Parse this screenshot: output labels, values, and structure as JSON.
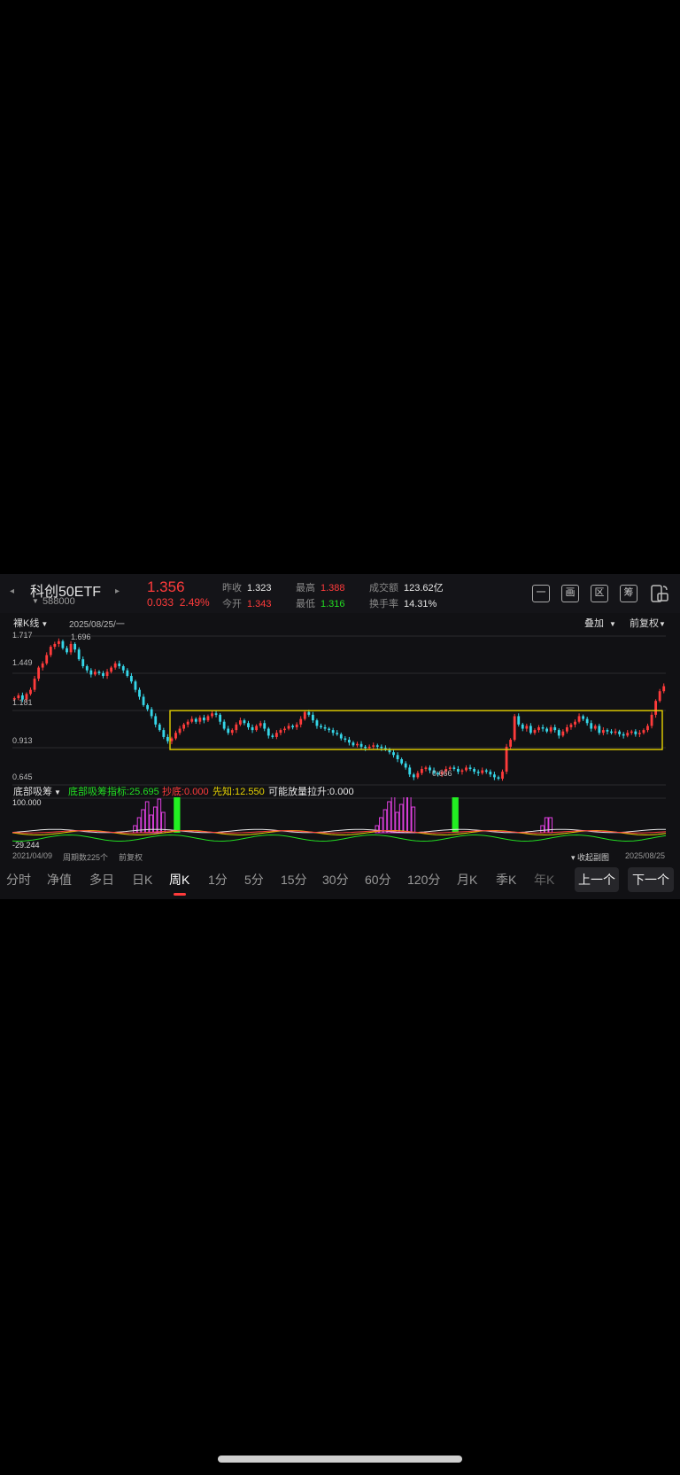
{
  "header": {
    "name": "科创50ETF",
    "code": "588000",
    "price": "1.356",
    "change": "0.033",
    "change_pct": "2.49%",
    "quotes": [
      {
        "key": "昨收",
        "value": "1.323",
        "tone": "white"
      },
      {
        "key": "今开",
        "value": "1.343",
        "tone": "red"
      },
      {
        "key": "最高",
        "value": "1.388",
        "tone": "red"
      },
      {
        "key": "最低",
        "value": "1.316",
        "tone": "green"
      },
      {
        "key": "成交额",
        "value": "123.62亿",
        "tone": "white"
      },
      {
        "key": "换手率",
        "value": "14.31%",
        "tone": "white"
      }
    ],
    "tools": [
      "一",
      "画",
      "区",
      "筹"
    ]
  },
  "chart": {
    "mode_label": "裸K线",
    "date_label": "2025/08/25/一",
    "overlay_label": "叠加",
    "adjust_label": "前复权",
    "y_labels": [
      "1.717",
      "1.449",
      "1.181",
      "0.913",
      "0.645"
    ],
    "high_note": "1.696",
    "low_note": "0.666",
    "up_color": "#ff3b3b",
    "down_color": "#35d6e8",
    "box_color": "#e6d200"
  },
  "indicator": {
    "name": "底部吸筹",
    "main": "底部吸筹指标:25.695",
    "chaodi": "抄底:0.000",
    "xianzhi": "先知:12.550",
    "lashen": "可能放量拉升:0.000",
    "top": "100.000",
    "bottom": "-29.244"
  },
  "footer": {
    "start_date": "2021/04/09",
    "period_count": "周期数225个",
    "adjust": "前复权",
    "collapse": "收起副图",
    "end_date": "2025/08/25"
  },
  "tabs": [
    "分时",
    "净值",
    "多日",
    "日K",
    "周K",
    "1分",
    "5分",
    "15分",
    "30分",
    "60分",
    "120分",
    "月K",
    "季K",
    "年K"
  ],
  "active_tab": "周K",
  "prev_label": "上一个",
  "next_label": "下一个",
  "chart_data": {
    "type": "candlestick",
    "period": "weekly",
    "ylim": [
      0.645,
      1.717
    ],
    "closes": [
      1.27,
      1.29,
      1.26,
      1.3,
      1.33,
      1.41,
      1.49,
      1.52,
      1.58,
      1.64,
      1.66,
      1.68,
      1.63,
      1.6,
      1.66,
      1.62,
      1.55,
      1.5,
      1.47,
      1.44,
      1.46,
      1.45,
      1.43,
      1.46,
      1.49,
      1.52,
      1.5,
      1.47,
      1.43,
      1.39,
      1.33,
      1.28,
      1.22,
      1.19,
      1.14,
      1.08,
      1.04,
      0.99,
      0.96,
      0.98,
      1.02,
      1.05,
      1.08,
      1.1,
      1.12,
      1.1,
      1.13,
      1.11,
      1.14,
      1.16,
      1.15,
      1.1,
      1.05,
      1.02,
      1.04,
      1.08,
      1.11,
      1.09,
      1.06,
      1.04,
      1.07,
      1.09,
      1.05,
      1.0,
      0.99,
      1.02,
      1.04,
      1.05,
      1.07,
      1.06,
      1.08,
      1.12,
      1.17,
      1.15,
      1.11,
      1.07,
      1.06,
      1.05,
      1.04,
      1.02,
      1.01,
      0.98,
      0.97,
      0.95,
      0.93,
      0.94,
      0.92,
      0.91,
      0.92,
      0.93,
      0.92,
      0.91,
      0.9,
      0.88,
      0.86,
      0.83,
      0.8,
      0.77,
      0.72,
      0.7,
      0.73,
      0.76,
      0.77,
      0.75,
      0.73,
      0.72,
      0.74,
      0.76,
      0.77,
      0.76,
      0.74,
      0.75,
      0.77,
      0.76,
      0.74,
      0.73,
      0.75,
      0.74,
      0.72,
      0.7,
      0.69,
      0.74,
      0.92,
      0.97,
      1.14,
      1.08,
      1.05,
      1.07,
      1.02,
      1.04,
      1.06,
      1.05,
      1.03,
      1.06,
      1.04,
      1.0,
      1.03,
      1.06,
      1.08,
      1.1,
      1.14,
      1.12,
      1.09,
      1.05,
      1.07,
      1.02,
      1.04,
      1.03,
      1.02,
      1.03,
      1.01,
      1.0,
      1.02,
      1.03,
      1.01,
      1.02,
      1.04,
      1.07,
      1.15,
      1.25,
      1.32,
      1.356
    ],
    "box_range": [
      1.18,
      0.9
    ],
    "indicator_range": [
      -29.244,
      100.0
    ]
  }
}
